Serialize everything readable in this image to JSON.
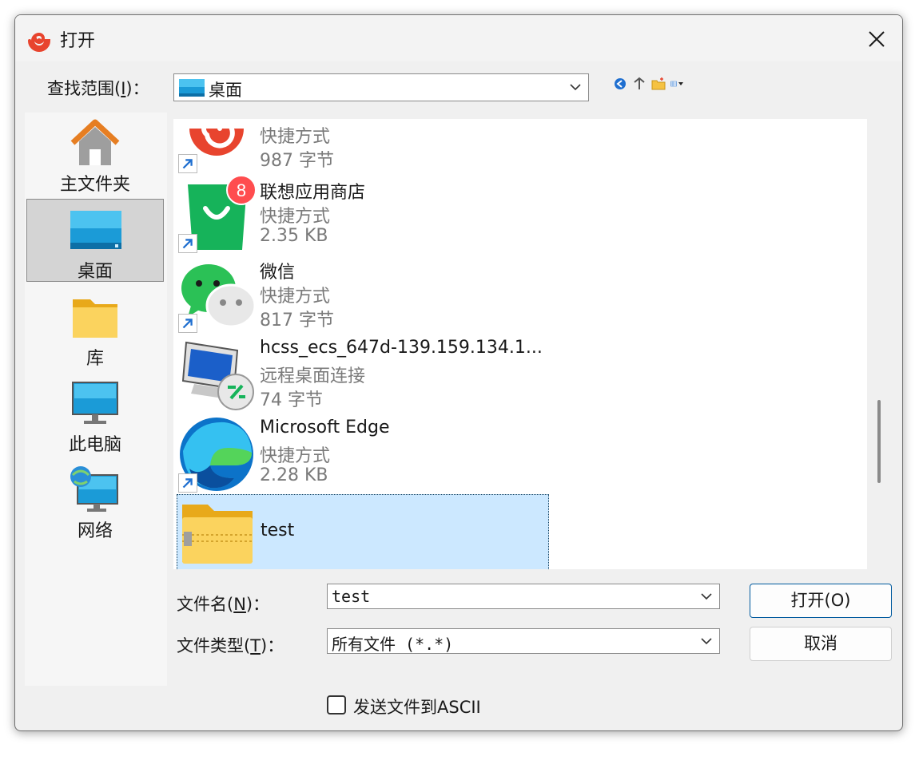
{
  "window": {
    "title": "打开"
  },
  "lookin": {
    "label_prefix": "查找范围(",
    "mnemonic": "I",
    "label_suffix": ")：",
    "value": "桌面"
  },
  "toolbar": {
    "icons": [
      "back-icon",
      "up-folder-icon",
      "new-folder-icon",
      "view-menu-icon"
    ]
  },
  "places": [
    {
      "label": "主文件夹",
      "icon": "home-icon",
      "selected": false
    },
    {
      "label": "桌面",
      "icon": "desktop-icon",
      "selected": true
    },
    {
      "label": "库",
      "icon": "library-folder-icon",
      "selected": false
    },
    {
      "label": "此电脑",
      "icon": "this-pc-icon",
      "selected": false
    },
    {
      "label": "网络",
      "icon": "network-icon",
      "selected": false
    }
  ],
  "files": [
    {
      "name": "",
      "type": "快捷方式",
      "size": "987 字节",
      "icon": "snail-app-icon",
      "shortcut": true
    },
    {
      "name": "联想应用商店",
      "type": "快捷方式",
      "size": "2.35 KB",
      "icon": "lenovo-store-icon",
      "badge": "8",
      "shortcut": true
    },
    {
      "name": "微信",
      "type": "快捷方式",
      "size": "817 字节",
      "icon": "wechat-icon",
      "shortcut": true
    },
    {
      "name": "hcss_ecs_647d-139.159.134.1...",
      "type": "远程桌面连接",
      "size": "74 字节",
      "icon": "remote-desktop-icon",
      "shortcut": false
    },
    {
      "name": "Microsoft Edge",
      "type": "快捷方式",
      "size": "2.28 KB",
      "icon": "edge-icon",
      "shortcut": true
    },
    {
      "name": "test",
      "type": "",
      "size": "",
      "icon": "zip-folder-icon",
      "shortcut": false,
      "selected": true
    }
  ],
  "filename": {
    "label_prefix": "文件名(",
    "mnemonic": "N",
    "label_suffix": ")：",
    "value": "test"
  },
  "filetype": {
    "label_prefix": "文件类型(",
    "mnemonic": "T",
    "label_suffix": ")：",
    "value": "所有文件 (*.*)"
  },
  "buttons": {
    "open": "打开(O)",
    "cancel": "取消"
  },
  "ascii_option": {
    "label": "发送文件到ASCII",
    "checked": false
  },
  "colors": {
    "selection": "#cce8ff",
    "primary_border": "#005a9e",
    "accent_red": "#e8442e",
    "lenovo_green": "#16b35a",
    "wechat_green": "#2bc156"
  }
}
